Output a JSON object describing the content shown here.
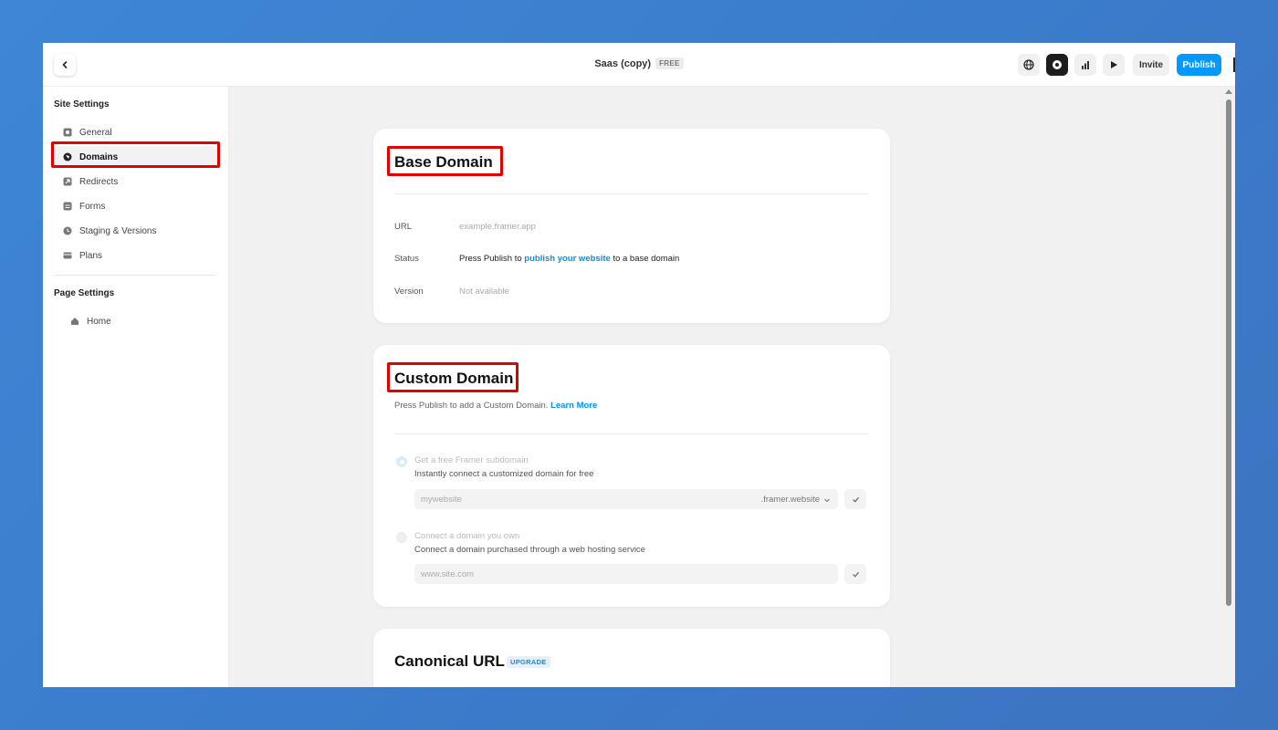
{
  "topbar": {
    "project_name": "Saas (copy)",
    "plan_badge": "FREE",
    "invite_label": "Invite",
    "publish_label": "Publish"
  },
  "sidebar": {
    "site_settings_title": "Site Settings",
    "items": [
      {
        "label": "General",
        "icon": "settings-icon"
      },
      {
        "label": "Domains",
        "icon": "domains-icon",
        "active": true
      },
      {
        "label": "Redirects",
        "icon": "redirect-icon"
      },
      {
        "label": "Forms",
        "icon": "forms-icon"
      },
      {
        "label": "Staging & Versions",
        "icon": "clock-icon"
      },
      {
        "label": "Plans",
        "icon": "card-icon"
      }
    ],
    "page_settings_title": "Page Settings",
    "pages": [
      {
        "label": "Home",
        "icon": "home-icon"
      }
    ]
  },
  "base_domain": {
    "title": "Base Domain",
    "url_label": "URL",
    "url_value": "example.framer.app",
    "status_label": "Status",
    "status_prefix": "Press Publish to",
    "status_link": "publish your website",
    "status_suffix": "to a base domain",
    "version_label": "Version",
    "version_value": "Not available"
  },
  "custom_domain": {
    "title": "Custom Domain",
    "description": "Press Publish to add a Custom Domain.",
    "learn_more": "Learn More",
    "option1_title": "Get a free Framer subdomain",
    "option1_desc": "Instantly connect a customized domain for free",
    "option1_placeholder": "mywebsite",
    "option1_suffix": ".framer.website",
    "option2_title": "Connect a domain you own",
    "option2_desc": "Connect a domain purchased through a web hosting service",
    "option2_placeholder": "www.site.com"
  },
  "canonical": {
    "title": "Canonical URL",
    "badge": "UPGRADE"
  },
  "colors": {
    "accent": "#0099ff",
    "highlight": "#e00000",
    "background": "#3f86d6"
  }
}
